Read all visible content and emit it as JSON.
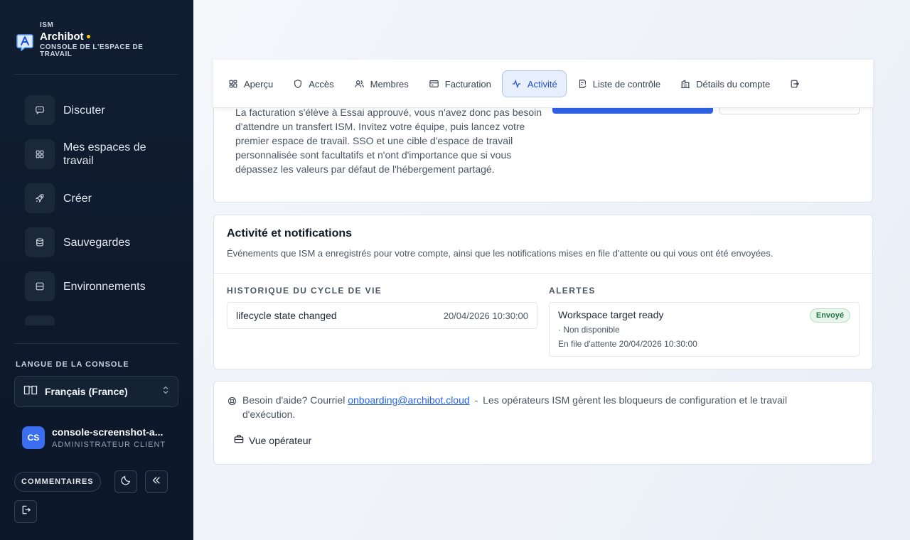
{
  "brand": {
    "org": "ISM",
    "name": "Archibot",
    "subtitle": "CONSOLE DE L'ESPACE DE TRAVAIL"
  },
  "sidebar": {
    "items": [
      {
        "label": "Discuter",
        "icon": "chat-icon"
      },
      {
        "label": "Mes espaces de travail",
        "icon": "grid-icon"
      },
      {
        "label": "Créer",
        "icon": "rocket-icon"
      },
      {
        "label": "Sauvegardes",
        "icon": "database-icon"
      },
      {
        "label": "Environnements",
        "icon": "server-icon"
      }
    ],
    "language_label": "LANGUE DE LA CONSOLE",
    "language_value": "Français (France)",
    "user": {
      "initials": "CS",
      "name": "console-screenshot-a...",
      "role": "ADMINISTRATEUR CLIENT"
    },
    "feedback_label": "COMMENTAIRES"
  },
  "tabs": [
    {
      "label": "Aperçu",
      "icon": "grid-icon",
      "active": false
    },
    {
      "label": "Accès",
      "icon": "shield-icon",
      "active": false
    },
    {
      "label": "Membres",
      "icon": "users-icon",
      "active": false
    },
    {
      "label": "Facturation",
      "icon": "credit-card-icon",
      "active": false
    },
    {
      "label": "Activité",
      "icon": "activity-icon",
      "active": true
    },
    {
      "label": "Liste de contrôle",
      "icon": "checklist-icon",
      "active": false
    },
    {
      "label": "Détails du compte",
      "icon": "building-icon",
      "active": false
    }
  ],
  "onboarding": {
    "text": "La facturation s'élève à Essai approuvé, vous n'avez donc pas besoin d'attendre un transfert ISM. Invitez votre équipe, puis lancez votre premier espace de travail. SSO et une cible d'espace de travail personnalisée sont facultatifs et n'ont d'importance que si vous dépassez les valeurs par défaut de l'hébergement partagé."
  },
  "activity": {
    "title": "Activité et notifications",
    "description": "Événements que ISM a enregistrés pour votre compte, ainsi que les notifications mises en file d'attente ou qui vous ont été envoyées.",
    "lifecycle_heading": "HISTORIQUE DU CYCLE DE VIE",
    "alerts_heading": "ALERTES",
    "lifecycle": [
      {
        "title": "lifecycle state changed",
        "date": "20/04/2026 10:30:00"
      }
    ],
    "alerts": [
      {
        "title": "Workspace target ready",
        "status": "Envoyé",
        "meta": "· Non disponible",
        "queued": "En file d'attente 20/04/2026 10:30:00"
      }
    ]
  },
  "help": {
    "prefix": "Besoin d'aide? Courriel",
    "email": "onboarding@archibot.cloud",
    "separator": "-",
    "suffix": "Les opérateurs ISM gèrent les bloqueurs de configuration et le travail d'exécution.",
    "operator_label": "Vue opérateur"
  },
  "colors": {
    "sidebar_bg": "#0f1b2d",
    "accent": "#2f62e6",
    "success": "#1f7a3f",
    "brand_dot": "#facc15"
  }
}
